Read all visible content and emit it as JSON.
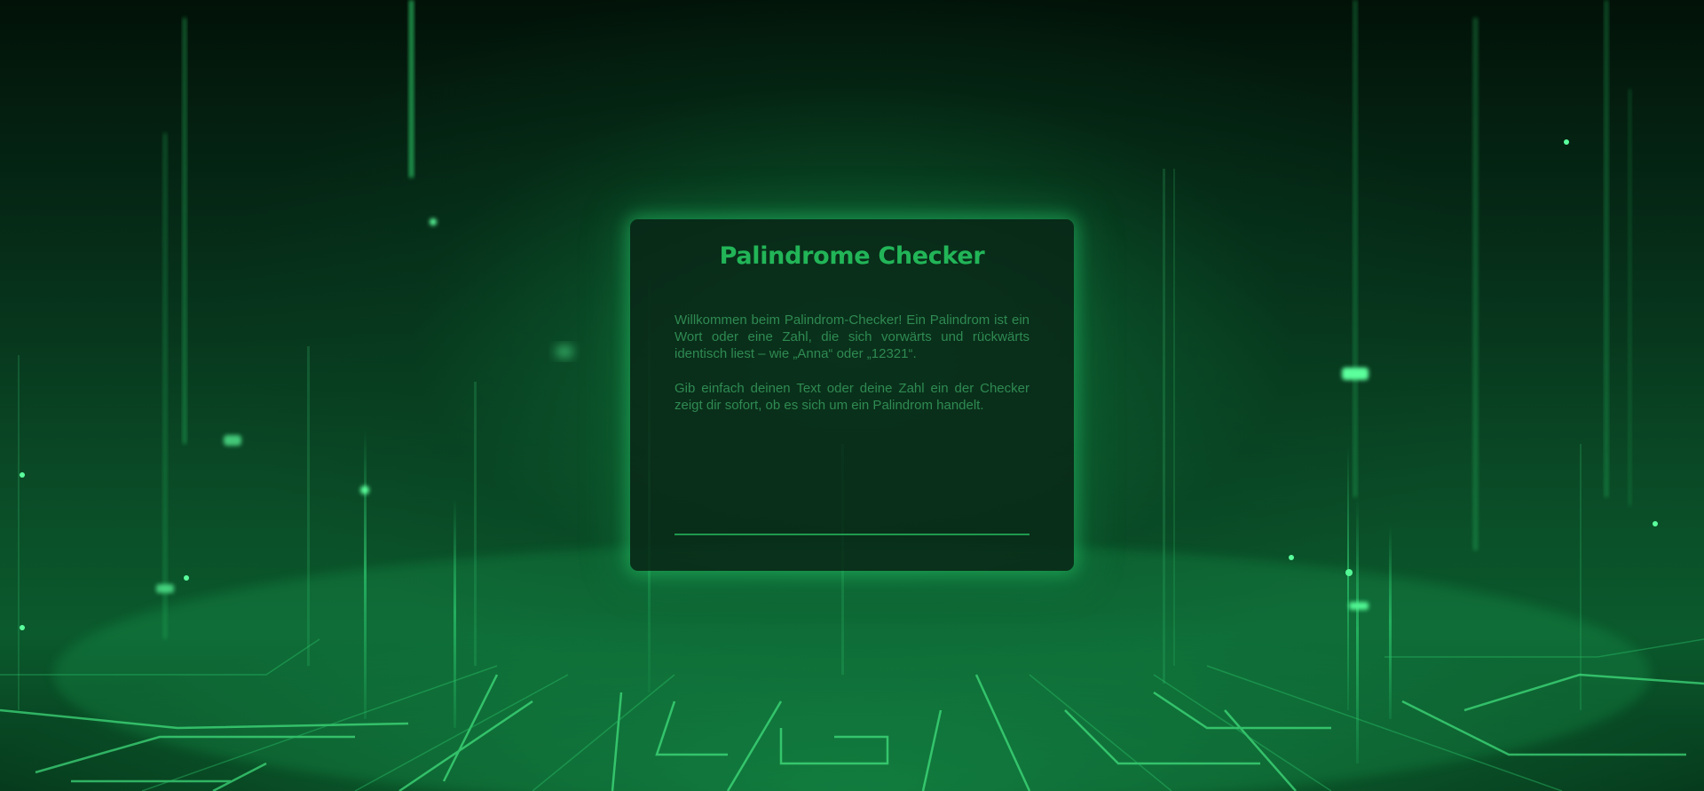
{
  "app": {
    "title": "Palindrome Checker"
  },
  "intro": {
    "paragraph_1": "Willkommen beim Palindrom-Checker! Ein Palindrom ist ein Wort oder eine Zahl, die sich vorwärts und rückwärts identisch liest – wie „Anna“ oder „12321“.",
    "paragraph_2": "Gib einfach deinen Text oder deine Zahl ein der Checker zeigt dir sofort, ob es sich um ein Palindrom handelt."
  },
  "input": {
    "value": "",
    "placeholder": ""
  },
  "theme": {
    "accent": "#22b558",
    "text": "#2f8a52",
    "card_bg": "#08261a",
    "glow": "#28d26e"
  }
}
